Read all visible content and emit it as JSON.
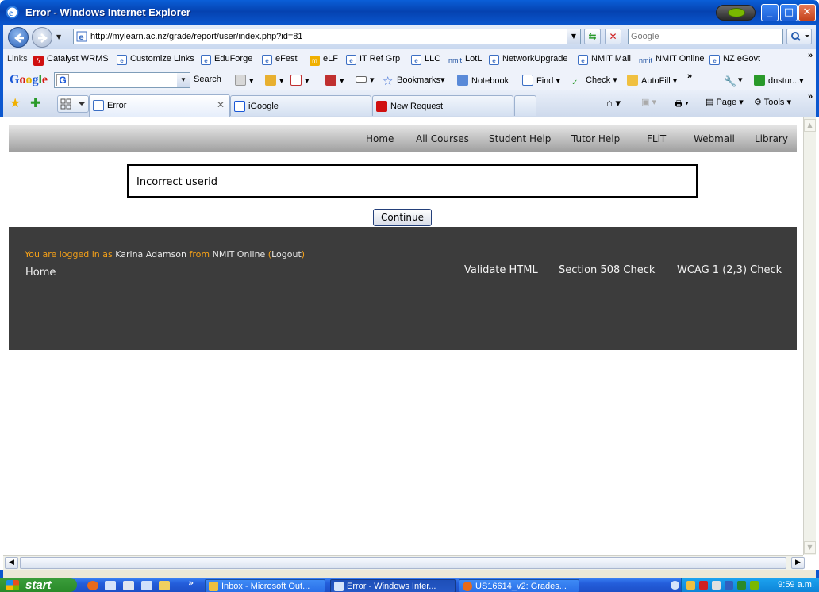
{
  "window": {
    "title": "Error - Windows Internet Explorer",
    "minimize": "_",
    "maximize": "□",
    "close": "✕"
  },
  "address": {
    "url": "http://mylearn.ac.nz/grade/report/user/index.php?id=81",
    "search_placeholder": "Google"
  },
  "links_bar": {
    "label": "Links",
    "items": [
      "Catalyst WRMS",
      "Customize Links",
      "EduForge",
      "eFest",
      "eLF",
      "IT Ref Grp",
      "LLC",
      "LotL",
      "NetworkUpgrade",
      "NMIT Mail",
      "NMIT Online",
      "NZ eGovt"
    ],
    "overflow": "»"
  },
  "google_bar": {
    "logo": "Google",
    "search_label": "Search",
    "bookmarks": "Bookmarks",
    "notebook": "Notebook",
    "find": "Find",
    "check": "Check",
    "autofill": "AutoFill",
    "user": "dnstur...",
    "overflow": "»"
  },
  "tabs": [
    {
      "title": "Error"
    },
    {
      "title": "iGoogle"
    },
    {
      "title": "New Request"
    }
  ],
  "command_bar": {
    "page": "Page",
    "tools": "Tools"
  },
  "site_menu": [
    "Home",
    "All Courses",
    "Student Help",
    "Tutor Help",
    "FLiT",
    "Webmail",
    "Library"
  ],
  "error": {
    "message": "Incorrect userid",
    "continue_label": "Continue"
  },
  "footer": {
    "logged_in_prefix": "You are logged in as",
    "user_name": "Karina Adamson",
    "from_word": "from",
    "site_name": "NMIT Online",
    "logout_open": "(",
    "logout": "Logout",
    "logout_close": ")",
    "home": "Home",
    "validate_html": "Validate HTML",
    "section_508": "Section 508 Check",
    "wcag": "WCAG 1 (2,3) Check"
  },
  "taskbar": {
    "start": "start",
    "items": [
      "Inbox - Microsoft Out...",
      "Error - Windows Inter...",
      "US16614_v2: Grades..."
    ],
    "clock": "9:59 a.m."
  },
  "colors": {
    "title_blue": "#0542b0",
    "footer_bg": "#3c3c3c",
    "footer_orange": "#f4a018",
    "menu_grey": "#a0a0a0"
  }
}
